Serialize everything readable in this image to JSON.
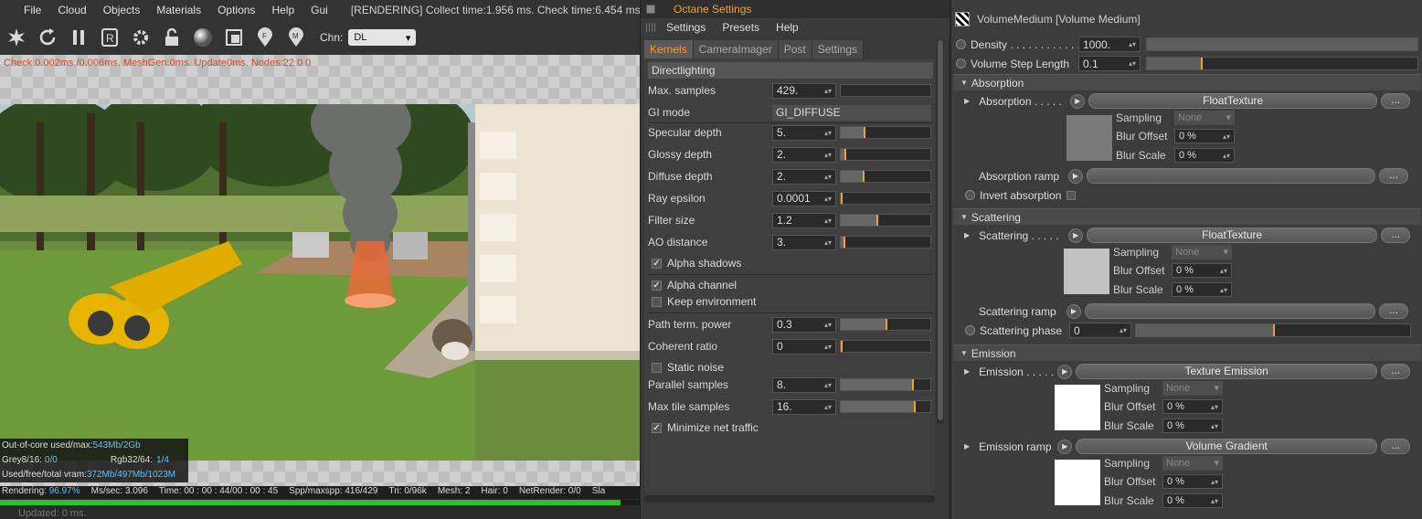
{
  "viewer": {
    "menu": [
      "File",
      "Cloud",
      "Objects",
      "Materials",
      "Options",
      "Help",
      "Gui"
    ],
    "status": "[RENDERING] Collect time:1.956 ms.  Check time:6.454 ms.  ch",
    "toolbar_icons": [
      "octane-logo-icon",
      "refresh-icon",
      "pause-icon",
      "region-icon",
      "settings-gear-icon",
      "lock-icon",
      "material-sphere-icon",
      "clay-mode-icon",
      "focus-pick-icon",
      "material-pick-icon"
    ],
    "chn_label": "Chn:",
    "chn_value": "DL",
    "check_line": "Check:0.002ms./0.006ms. MeshGen:0ms. Update0ms. Nodes:22  0  0",
    "stats": {
      "out_of_core_label": "Out-of-core used/max:",
      "out_of_core_value": "543Mb/2Gb",
      "grey_label": "Grey8/16:",
      "grey_value": "0/0",
      "rgb_label": "Rgb32/64:",
      "rgb_value": "1/4",
      "vram_label": "Used/free/total vram:",
      "vram_value": "372Mb/497Mb/1023M"
    },
    "bottom": {
      "rendering_label": "Rendering:",
      "rendering_value": "96.97%",
      "ms_label": "Ms/sec:",
      "ms_value": "3.096",
      "time_label": "Time:",
      "time_value": "00 : 00 : 44/00 : 00 : 45",
      "spp_label": "Spp/maxspp:",
      "spp_value": "416/429",
      "tri_label": "Tri:",
      "tri_value": "0/96k",
      "mesh_label": "Mesh:",
      "mesh_value": "2",
      "hair_label": "Hair:",
      "hair_value": "0",
      "net_label": "NetRender:",
      "net_value": "0/0",
      "sla_label": "Sla"
    },
    "progress": 0.9697,
    "updated": "Updated: 0 ms."
  },
  "octane": {
    "title": "Octane Settings",
    "menu": [
      "Settings",
      "Presets",
      "Help"
    ],
    "tabs": [
      "Kernels",
      "CameraImager",
      "Post",
      "Settings"
    ],
    "section": "Directlighting",
    "max_samples": {
      "label": "Max. samples",
      "value": "429.",
      "level": 0.0
    },
    "gi_mode": {
      "label": "GI mode",
      "value": "GI_DIFFUSE"
    },
    "specular": {
      "label": "Specular depth",
      "value": "5.",
      "level": 0.26
    },
    "glossy": {
      "label": "Glossy depth",
      "value": "2.",
      "level": 0.04
    },
    "diffuse": {
      "label": "Diffuse depth",
      "value": "2.",
      "level": 0.24
    },
    "ray_eps": {
      "label": "Ray epsilon",
      "value": "0.0001",
      "level": 0.0
    },
    "filter": {
      "label": "Filter size",
      "value": "1.2",
      "level": 0.4
    },
    "ao": {
      "label": "AO distance",
      "value": "3.",
      "level": 0.03
    },
    "alpha_shadows": {
      "label": "Alpha shadows",
      "checked": true
    },
    "alpha_channel": {
      "label": "Alpha channel",
      "checked": true
    },
    "keep_env": {
      "label": "Keep environment",
      "checked": false
    },
    "path_term": {
      "label": "Path term. power",
      "value": "0.3",
      "level": 0.5
    },
    "coherent": {
      "label": "Coherent ratio",
      "value": "0",
      "level": 0.0
    },
    "static_noise": {
      "label": "Static noise",
      "checked": false
    },
    "parallel": {
      "label": "Parallel samples",
      "value": "8.",
      "level": 0.8
    },
    "max_tile": {
      "label": "Max tile samples",
      "value": "16.",
      "level": 0.82
    },
    "min_net": {
      "label": "Minimize net traffic",
      "checked": true
    }
  },
  "attr": {
    "title": "VolumeMedium [Volume Medium]",
    "density": {
      "label": "Density . . . . . . . . . . . .",
      "value": "1000.",
      "level": 1.0
    },
    "step": {
      "label": "Volume Step Length",
      "value": "0.1",
      "level": 0.2
    },
    "absorption": {
      "group": "Absorption",
      "label": "Absorption . . . . .",
      "texture": "FloatTexture",
      "swatch": "#7a7a7a",
      "sampling_label": "Sampling",
      "sampling_value": "None",
      "blur_offset_label": "Blur Offset",
      "blur_offset_value": "0 %",
      "blur_scale_label": "Blur Scale",
      "blur_scale_value": "0 %",
      "ramp_label": "Absorption ramp",
      "invert_label": "Invert absorption"
    },
    "scattering": {
      "group": "Scattering",
      "label": "Scattering . . . . .",
      "texture": "FloatTexture",
      "swatch": "#c2c2c2",
      "sampling_label": "Sampling",
      "sampling_value": "None",
      "blur_offset_label": "Blur Offset",
      "blur_offset_value": "0 %",
      "blur_scale_label": "Blur Scale",
      "blur_scale_value": "0 %",
      "ramp_label": "Scattering ramp",
      "phase_label": "Scattering phase",
      "phase_value": "0",
      "phase_level": 0.5
    },
    "emission": {
      "group": "Emission",
      "label": "Emission . . . . .",
      "texture": "Texture Emission",
      "swatch": "#ffffff",
      "sampling_label": "Sampling",
      "sampling_value": "None",
      "blur_offset_label": "Blur Offset",
      "blur_offset_value": "0 %",
      "blur_scale_label": "Blur Scale",
      "blur_scale_value": "0 %",
      "ramp_label": "Emission ramp",
      "ramp_texture": "Volume Gradient",
      "ramp_swatch": "#ffffff",
      "ramp_sampling_value": "None",
      "ramp_blur_offset_value": "0 %",
      "ramp_blur_scale_value": "0 %"
    },
    "dots": "..."
  }
}
